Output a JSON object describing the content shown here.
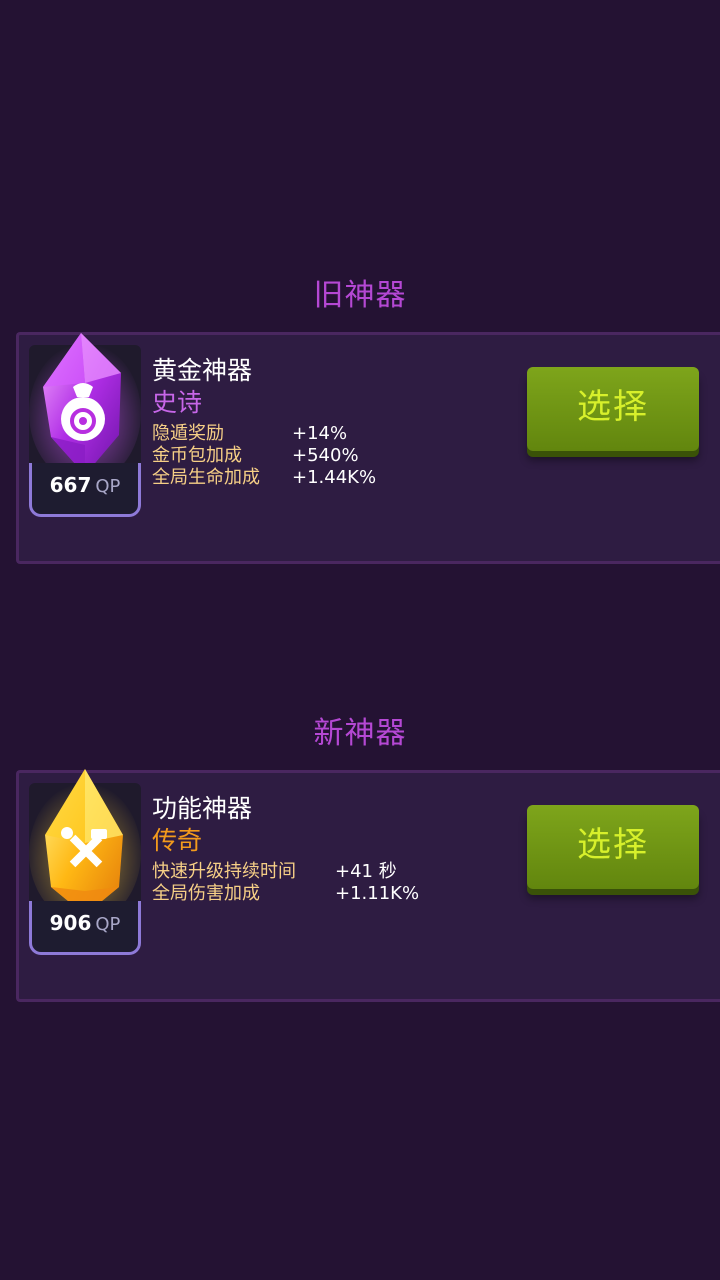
{
  "old_section": {
    "title": "旧神器",
    "artifact": {
      "name": "黄金神器",
      "rarity": "史诗",
      "rarity_color": "#c766e8",
      "qp_value": "667",
      "qp_unit": "QP",
      "gem_color": "#c23dff",
      "icon": "money-bag-icon",
      "stats": [
        {
          "label": "隐遁奖励",
          "value": "+14%"
        },
        {
          "label": "金币包加成",
          "value": "+540%"
        },
        {
          "label": "全局生命加成",
          "value": "+1.44K%"
        }
      ]
    },
    "button_label": "选择"
  },
  "new_section": {
    "title": "新神器",
    "artifact": {
      "name": "功能神器",
      "rarity": "传奇",
      "rarity_color": "#f39a1c",
      "qp_value": "906",
      "qp_unit": "QP",
      "gem_color": "#ffc21a",
      "icon": "hammer-wrench-icon",
      "stats": [
        {
          "label": "快速升级持续时间",
          "value": "+41 秒"
        },
        {
          "label": "全局伤害加成",
          "value": "+1.11K%"
        }
      ]
    },
    "button_label": "选择"
  }
}
